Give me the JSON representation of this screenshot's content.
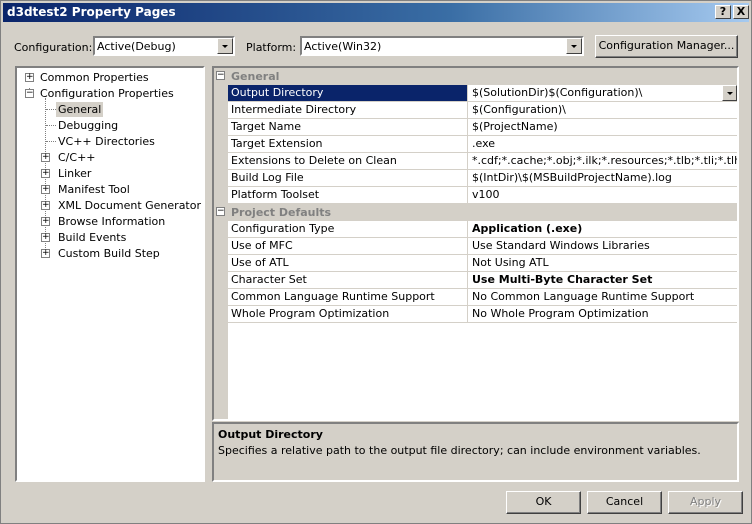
{
  "window": {
    "title": "d3dtest2 Property Pages",
    "help_btn": "?",
    "close_btn": "X"
  },
  "config": {
    "configuration_label": "Configuration:",
    "configuration_value": "Active(Debug)",
    "platform_label": "Platform:",
    "platform_value": "Active(Win32)",
    "manager_button": "Configuration Manager..."
  },
  "tree": {
    "common_properties": "Common Properties",
    "configuration_properties": "Configuration Properties",
    "general": "General",
    "debugging": "Debugging",
    "vc_directories": "VC++ Directories",
    "c_cpp": "C/C++",
    "linker": "Linker",
    "manifest_tool": "Manifest Tool",
    "xml_doc_gen": "XML Document Generator",
    "browse_info": "Browse Information",
    "build_events": "Build Events",
    "custom_build_step": "Custom Build Step"
  },
  "grid": {
    "cat_general": "General",
    "general_rows": [
      {
        "name": "Output Directory",
        "value": "$(SolutionDir)$(Configuration)\\"
      },
      {
        "name": "Intermediate Directory",
        "value": "$(Configuration)\\"
      },
      {
        "name": "Target Name",
        "value": "$(ProjectName)"
      },
      {
        "name": "Target Extension",
        "value": ".exe"
      },
      {
        "name": "Extensions to Delete on Clean",
        "value": "*.cdf;*.cache;*.obj;*.ilk;*.resources;*.tlb;*.tli;*.tlh;*.tmp;*.rsp;*.pgc;*.pgd"
      },
      {
        "name": "Build Log File",
        "value": "$(IntDir)\\$(MSBuildProjectName).log"
      },
      {
        "name": "Platform Toolset",
        "value": "v100"
      }
    ],
    "cat_project_defaults": "Project Defaults",
    "defaults_rows": [
      {
        "name": "Configuration Type",
        "value": "Application (.exe)"
      },
      {
        "name": "Use of MFC",
        "value": "Use Standard Windows Libraries"
      },
      {
        "name": "Use of ATL",
        "value": "Not Using ATL"
      },
      {
        "name": "Character Set",
        "value": "Use Multi-Byte Character Set"
      },
      {
        "name": "Common Language Runtime Support",
        "value": "No Common Language Runtime Support"
      },
      {
        "name": "Whole Program Optimization",
        "value": "No Whole Program Optimization"
      }
    ]
  },
  "description": {
    "title": "Output Directory",
    "text": "Specifies a relative path to the output file directory; can include environment variables."
  },
  "buttons": {
    "ok": "OK",
    "cancel": "Cancel",
    "apply": "Apply"
  },
  "colors": {
    "selection": "#0a246a",
    "titlebar": "#0a246a",
    "face": "#d4d0c8"
  }
}
